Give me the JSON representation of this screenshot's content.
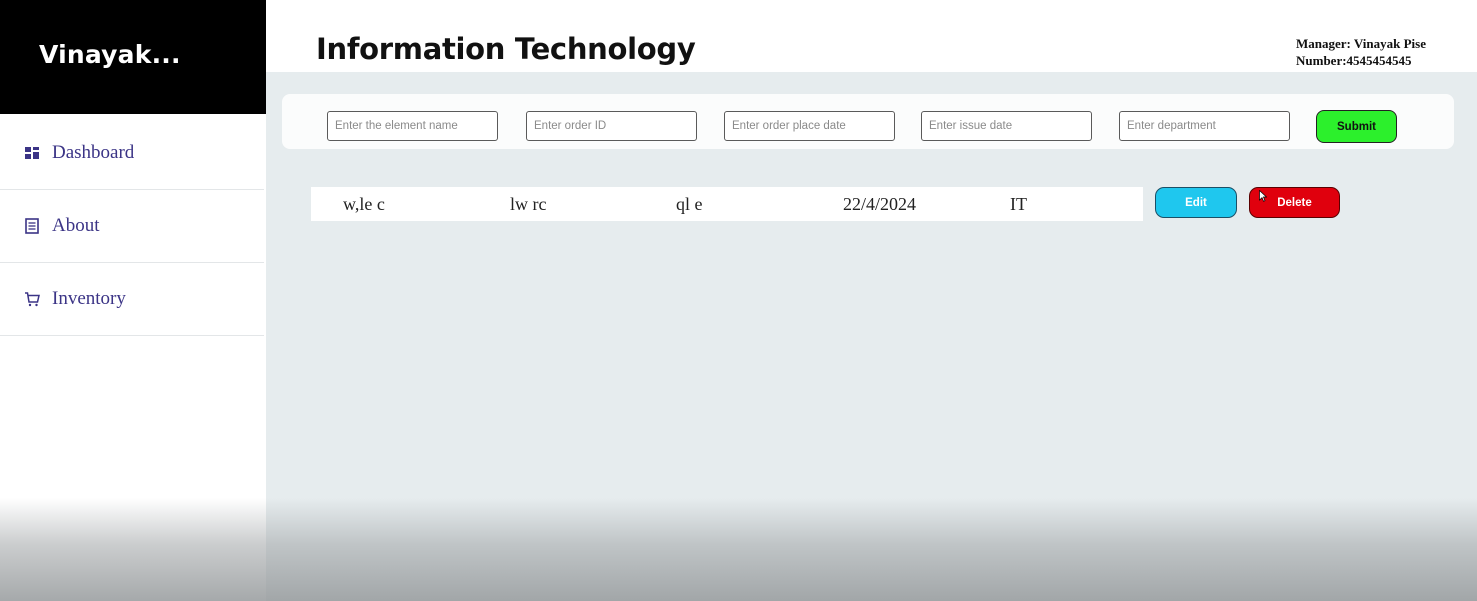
{
  "sidebar": {
    "brand": "Vinayak...",
    "items": [
      {
        "label": "Dashboard",
        "icon": "dashboard-icon"
      },
      {
        "label": "About",
        "icon": "document-icon"
      },
      {
        "label": "Inventory",
        "icon": "cart-icon"
      }
    ]
  },
  "header": {
    "title": "Information Technology",
    "manager": "Manager: Vinayak Pise",
    "number": "Number:4545454545"
  },
  "form": {
    "element_name_placeholder": "Enter the element name",
    "order_id_placeholder": "Enter order ID",
    "order_date_placeholder": "Enter order place date",
    "issue_date_placeholder": "Enter issue date",
    "department_placeholder": "Enter department",
    "submit_label": "Submit"
  },
  "records": [
    {
      "element_name": "w,le c",
      "order_id": "lw rc",
      "order_place_date": "ql e",
      "issue_date": "22/4/2024",
      "department": "IT"
    }
  ],
  "actions": {
    "edit_label": "Edit",
    "delete_label": "Delete"
  },
  "colors": {
    "brand_bg": "#000000",
    "nav_text": "#3b3486",
    "main_bg": "#e6ecee",
    "submit": "#2cf02c",
    "edit": "#1fc7ee",
    "delete": "#e0000d"
  }
}
